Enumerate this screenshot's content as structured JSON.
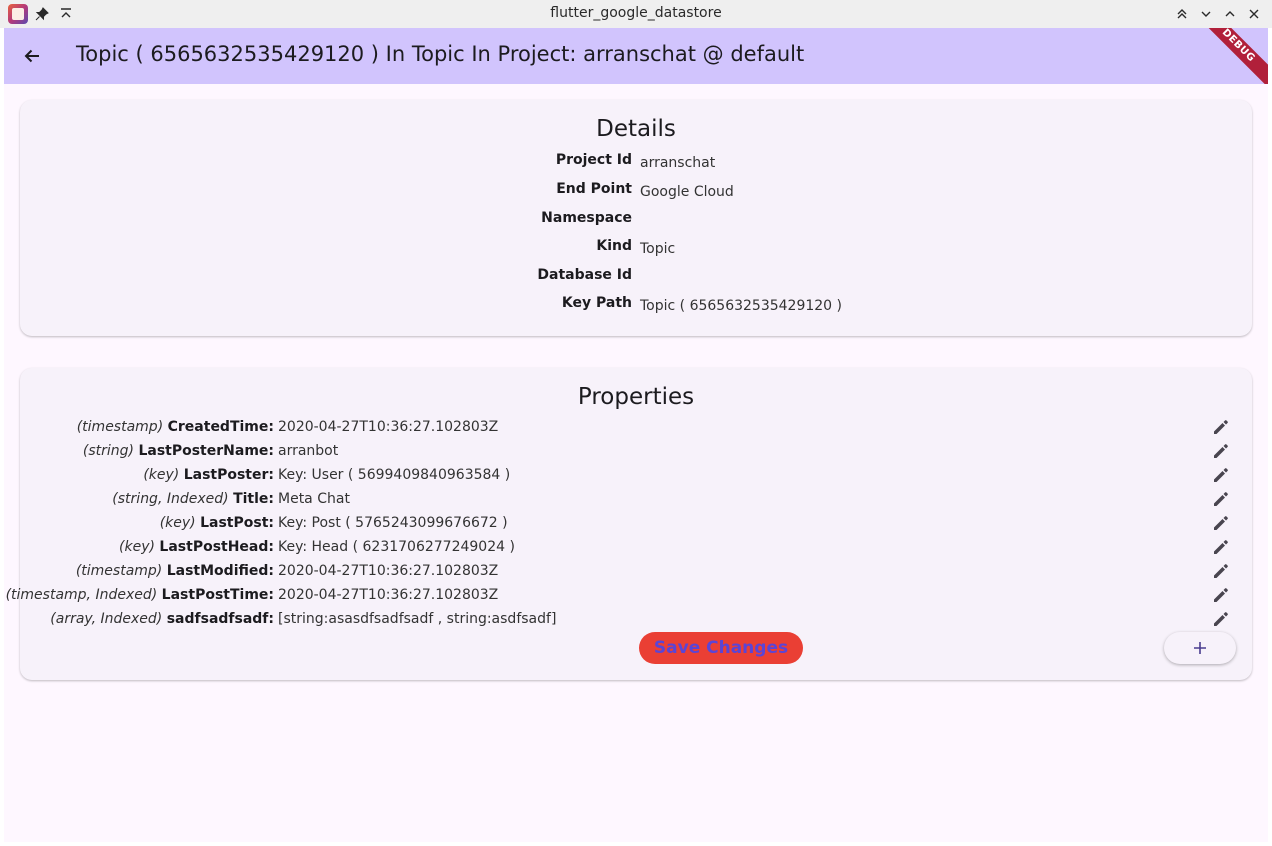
{
  "window": {
    "title": "flutter_google_datastore",
    "icons": [
      "app-icon",
      "pin-icon",
      "keep-above-icon",
      "shade-icon",
      "minimize-icon",
      "maximize-icon",
      "close-icon"
    ]
  },
  "appbar": {
    "title": "Topic ( 6565632535429120 ) In Topic In Project: arranschat @ default",
    "debug_label": "DEBUG",
    "background": "#d1c4fd"
  },
  "details": {
    "heading": "Details",
    "rows": [
      {
        "label": "Project Id",
        "value": "arranschat"
      },
      {
        "label": "End Point",
        "value": "Google Cloud"
      },
      {
        "label": "Namespace",
        "value": ""
      },
      {
        "label": "Kind",
        "value": "Topic"
      },
      {
        "label": "Database Id",
        "value": ""
      },
      {
        "label": "Key Path",
        "value": "Topic ( 6565632535429120 )"
      }
    ]
  },
  "properties": {
    "heading": "Properties",
    "rows": [
      {
        "type": "(timestamp)",
        "name": "CreatedTime:",
        "value": "2020-04-27T10:36:27.102803Z"
      },
      {
        "type": "(string)",
        "name": "LastPosterName:",
        "value": "arranbot"
      },
      {
        "type": "(key)",
        "name": "LastPoster:",
        "value": "Key: User ( 5699409840963584 )"
      },
      {
        "type": "(string, Indexed)",
        "name": "Title:",
        "value": "Meta Chat"
      },
      {
        "type": "(key)",
        "name": "LastPost:",
        "value": "Key: Post ( 5765243099676672 )"
      },
      {
        "type": "(key)",
        "name": "LastPostHead:",
        "value": "Key: Head ( 6231706277249024 )"
      },
      {
        "type": "(timestamp)",
        "name": "LastModified:",
        "value": "2020-04-27T10:36:27.102803Z"
      },
      {
        "type": "(timestamp, Indexed)",
        "name": "LastPostTime:",
        "value": "2020-04-27T10:36:27.102803Z"
      },
      {
        "type": "(array, Indexed)",
        "name": "sadfsadfsadf:",
        "value": "[string:asasdfsadfsadf , string:asdfsadf]"
      }
    ],
    "save_label": "Save Changes",
    "save_color": "#ea3f34",
    "add_icon": "plus-icon",
    "edit_icon": "pencil-icon"
  }
}
